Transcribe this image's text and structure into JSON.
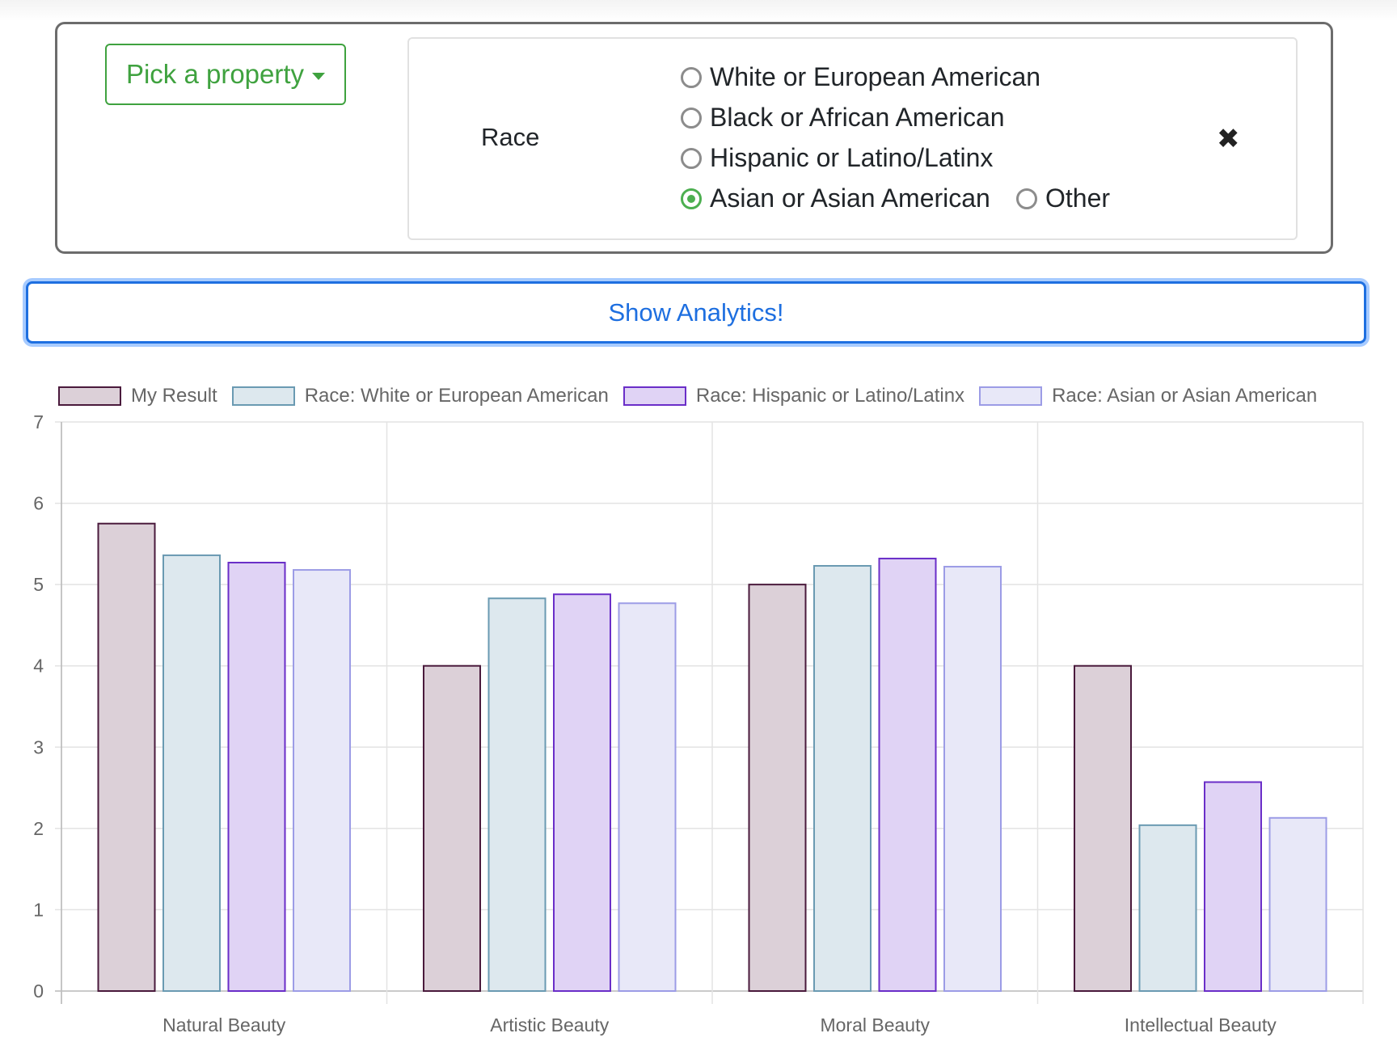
{
  "filter": {
    "pick_label": "Pick a property",
    "property_label": "Race",
    "options": [
      {
        "label": "White or European American",
        "checked": false
      },
      {
        "label": "Black or African American",
        "checked": false
      },
      {
        "label": "Hispanic or Latino/Latinx",
        "checked": false
      },
      {
        "label": "Asian or Asian American",
        "checked": true
      },
      {
        "label": "Other",
        "checked": false
      }
    ],
    "remove_icon": "close-icon",
    "remove_glyph": "✖"
  },
  "show_button": {
    "label": "Show Analytics!"
  },
  "colors": {
    "accent_green": "#3fa23f",
    "primary_blue": "#1e6fe0"
  },
  "chart_data": {
    "type": "bar",
    "categories": [
      "Natural Beauty",
      "Artistic Beauty",
      "Moral Beauty",
      "Intellectual Beauty"
    ],
    "series": [
      {
        "name": "My Result",
        "values": [
          5.75,
          4.0,
          5.0,
          4.0
        ],
        "fill": "#dcd0d8",
        "stroke": "#4a1a3c"
      },
      {
        "name": "Race: White or European American",
        "values": [
          5.36,
          4.83,
          5.23,
          2.04
        ],
        "fill": "#dde8ee",
        "stroke": "#6a9ab2"
      },
      {
        "name": "Race: Hispanic or Latino/Latinx",
        "values": [
          5.27,
          4.88,
          5.32,
          2.57
        ],
        "fill": "#e0d3f5",
        "stroke": "#6a2ec8"
      },
      {
        "name": "Race: Asian or Asian American",
        "values": [
          5.18,
          4.77,
          5.22,
          2.13
        ],
        "fill": "#e8e8f8",
        "stroke": "#9c9ce6"
      }
    ],
    "y_ticks": [
      "0",
      "1",
      "2",
      "3",
      "4",
      "5",
      "6",
      "7"
    ],
    "ylim": [
      0,
      7
    ],
    "grid": true,
    "legend_position": "top"
  }
}
